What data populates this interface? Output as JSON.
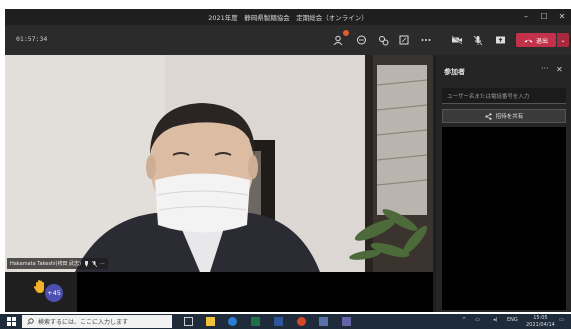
{
  "window": {
    "title": "2021年度　静岡県製麺協会　定期総会（オンライン）",
    "minimize": "–",
    "maximize": "☐",
    "close": "✕"
  },
  "meeting": {
    "timer": "01:57:34",
    "leave_label": "退出",
    "participant_badge": "",
    "icons": [
      "participants-icon",
      "chat-icon",
      "reactions-icon",
      "rooms-icon",
      "more-icon",
      "camera-off-icon",
      "mic-off-icon",
      "share-icon"
    ]
  },
  "video": {
    "name_tag": "Hakamata Takeshi(袴田 武志)"
  },
  "strip": {
    "raised_count": "+45"
  },
  "participants_pane": {
    "title": "参加者",
    "search_placeholder": "ユーザー名または電話番号を入力",
    "share_invite_label": "招待を共有"
  },
  "taskbar": {
    "search_placeholder": "検索するには、ここに入力します",
    "language": "ENG",
    "time": "15:05",
    "date": "2021/04/14"
  },
  "colors": {
    "leave_red": "#c4314b",
    "accent_purple": "#4a4fb0",
    "taskbar": "#1d2b3a"
  }
}
